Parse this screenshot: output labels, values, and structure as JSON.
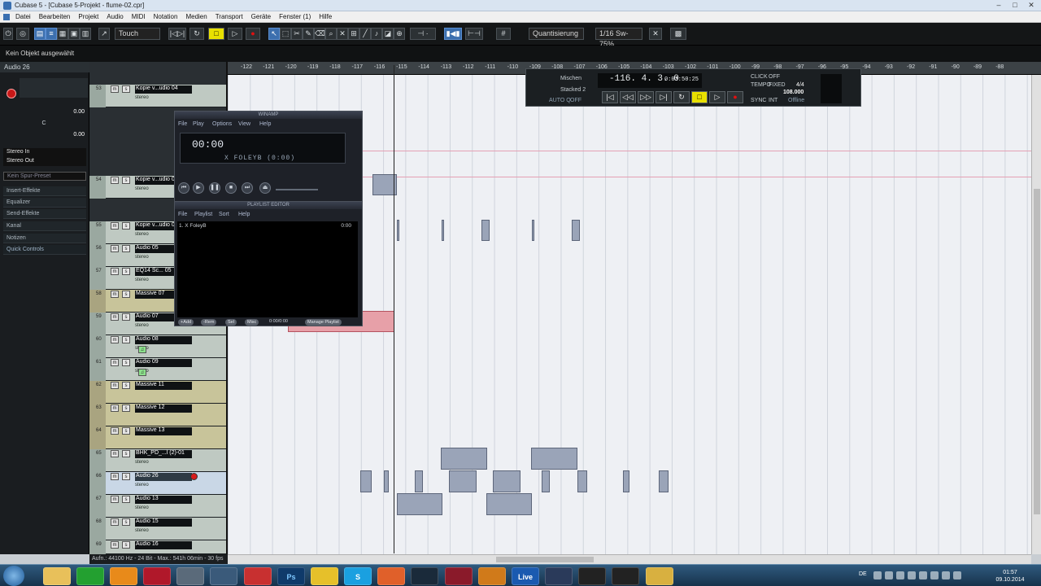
{
  "window": {
    "title": "Cubase 5 - [Cubase 5-Projekt - flume-02.cpr]",
    "controls": [
      "–",
      "□",
      "✕"
    ]
  },
  "menu": [
    "Datei",
    "Bearbeiten",
    "Projekt",
    "Audio",
    "MIDI",
    "Notation",
    "Medien",
    "Transport",
    "Geräte",
    "Fenster (1)",
    "Hilfe"
  ],
  "toolbar": {
    "automation_mode": "Touch",
    "quantize_label": "Quantisierung",
    "quantize_value": "1/16 Sw-75%"
  },
  "status": {
    "info": "Kein Objekt ausgewählt"
  },
  "inspector": {
    "track_name": "Audio 26",
    "vol_value": "0.00",
    "pan_value": "C",
    "delay_value": "0.00",
    "input": "Stereo In",
    "output": "Stereo Out",
    "preset": "Kein Spur-Preset",
    "sections": [
      "Insert-Effekte",
      "Equalizer",
      "Send-Effekte",
      "Kanal",
      "Notizen",
      "Quick Controls"
    ]
  },
  "tracks": [
    {
      "num": "53",
      "name": "Kopie v...udio 04",
      "sub": "stereo"
    },
    {
      "num": "54",
      "name": "Kopie v...udio 05",
      "sub": "stereo"
    },
    {
      "num": "55",
      "name": "Kopie v...udio 06",
      "sub": "stereo"
    },
    {
      "num": "56",
      "name": "Audio 05",
      "sub": "stereo"
    },
    {
      "num": "57",
      "name": "EQ14 Sc... 05",
      "sub": "stereo"
    },
    {
      "num": "58",
      "name": "Massive 07",
      "sub": ""
    },
    {
      "num": "59",
      "name": "Audio 07",
      "sub": "stereo"
    },
    {
      "num": "60",
      "name": "Audio 08",
      "sub": "stereo"
    },
    {
      "num": "61",
      "name": "Audio 09",
      "sub": "stereo"
    },
    {
      "num": "62",
      "name": "Massive 11",
      "sub": ""
    },
    {
      "num": "63",
      "name": "Massive 12",
      "sub": ""
    },
    {
      "num": "64",
      "name": "Massive 13",
      "sub": ""
    },
    {
      "num": "65",
      "name": "BHK_PD_...l (2)-01",
      "sub": "stereo"
    },
    {
      "num": "66",
      "name": "Audio 26",
      "sub": "stereo"
    },
    {
      "num": "67",
      "name": "Audio 13",
      "sub": "stereo"
    },
    {
      "num": "68",
      "name": "Audio 15",
      "sub": "stereo"
    },
    {
      "num": "69",
      "name": "Audio 16",
      "sub": "stereo"
    }
  ],
  "ruler": [
    "-122",
    "-121",
    "-120",
    "-119",
    "-118",
    "-117",
    "-116",
    "-115",
    "-114",
    "-113",
    "-112",
    "-111",
    "-110",
    "-109",
    "-108",
    "-107",
    "-106",
    "-105",
    "-104",
    "-103",
    "-102",
    "-101",
    "-100",
    "-99",
    "-98",
    "-97",
    "-96",
    "-95",
    "-94",
    "-93",
    "-92",
    "-91",
    "-90",
    "-89",
    "-88"
  ],
  "transport": {
    "mode1": "Mischen",
    "mode2": "Stacked 2",
    "auto_quant": "AUTO Q",
    "auto_state": "OFF",
    "position": "-116. 4. 3.  0",
    "time": "0:03:50:25",
    "click": "CLICK",
    "click_state": "OFF",
    "tempo_label": "TEMPO",
    "fixed_label": "FIXED",
    "signature": "4/4",
    "tempo": "108.000",
    "sync_label": "SYNC",
    "int_label": "INT",
    "offline": "Offline"
  },
  "winamp": {
    "title": "WINAMP",
    "menu": [
      "File",
      "Play",
      "Options",
      "View",
      "Help"
    ],
    "time": "00:00",
    "song": "X FOLEYB (0:00)"
  },
  "playlist": {
    "title": "PLAYLIST EDITOR",
    "menu": [
      "File",
      "Playlist",
      "Sort",
      "Help"
    ],
    "item": "1. X FoleyB",
    "duration": "0:00",
    "buttons": [
      "+Add",
      "-Rem",
      "Sel",
      "Misc",
      "0:00/0:00",
      "Manage Playlist"
    ]
  },
  "bottom_info": "Aufn.: 44100 Hz - 24 Bit - Max.: 541h 06min - 30 fps",
  "taskbar": {
    "apps": [
      "",
      "",
      "",
      "",
      "",
      "",
      "",
      "Ps",
      "",
      "S",
      "",
      "",
      "",
      "",
      "Live",
      "",
      "",
      "",
      ""
    ],
    "lang": "DE",
    "time": "01:57",
    "date": "09.10.2014"
  }
}
